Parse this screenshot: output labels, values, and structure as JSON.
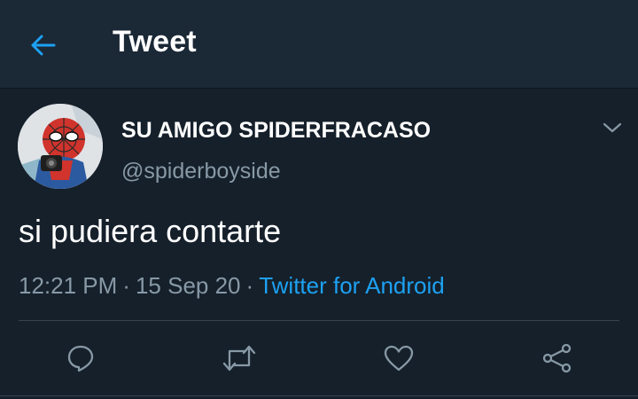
{
  "header": {
    "title": "Tweet",
    "back_icon": "arrow-left-icon"
  },
  "tweet": {
    "author": {
      "display_name": "SU AMIGO SPIDERFRACASO",
      "handle": "@spiderboyside",
      "avatar": "spider-man-comic-avatar"
    },
    "text": "si pudiera contarte",
    "time": "12:21 PM",
    "date": "15 Sep 20",
    "separator": "·",
    "source": "Twitter for Android"
  },
  "actions": [
    {
      "icon": "reply-icon"
    },
    {
      "icon": "retweet-icon"
    },
    {
      "icon": "like-icon"
    },
    {
      "icon": "share-icon"
    }
  ],
  "colors": {
    "background": "#15202b",
    "header_background": "#1b2836",
    "accent": "#1da1f2",
    "secondary_text": "#8899a6",
    "divider": "#38444d"
  }
}
